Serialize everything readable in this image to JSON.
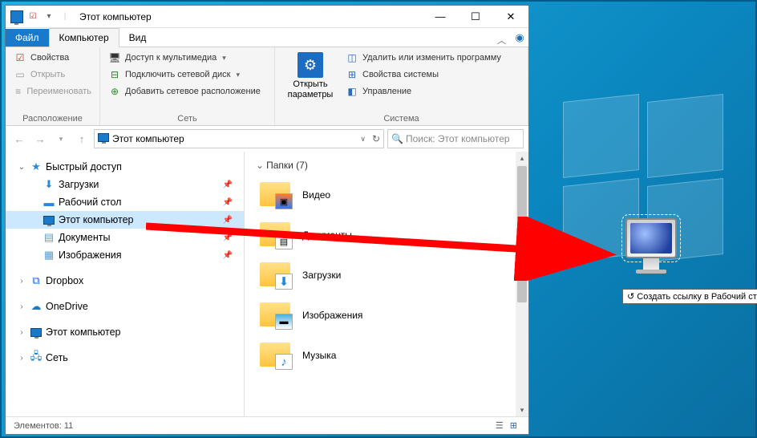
{
  "window": {
    "title": "Этот компьютер",
    "tabs": {
      "file": "Файл",
      "computer": "Компьютер",
      "view": "Вид"
    }
  },
  "ribbon": {
    "group1": {
      "label": "Расположение",
      "properties": "Свойства",
      "open": "Открыть",
      "rename": "Переименовать"
    },
    "group2": {
      "label": "Сеть",
      "media": "Доступ к мультимедиа",
      "mapdrive": "Подключить сетевой диск",
      "addloc": "Добавить сетевое расположение"
    },
    "group3": {
      "label": "Система",
      "big": "Открыть параметры",
      "uninstall": "Удалить или изменить программу",
      "sysprops": "Свойства системы",
      "manage": "Управление"
    }
  },
  "addressbar": {
    "path": "Этот компьютер"
  },
  "search": {
    "placeholder": "Поиск: Этот компьютер"
  },
  "sidebar": {
    "quick": "Быстрый доступ",
    "downloads": "Загрузки",
    "desktop": "Рабочий стол",
    "thispc": "Этот компьютер",
    "documents": "Документы",
    "pictures": "Изображения",
    "dropbox": "Dropbox",
    "onedrive": "OneDrive",
    "thispc2": "Этот компьютер",
    "network": "Сеть"
  },
  "content": {
    "header": "Папки (7)",
    "folders": {
      "video": "Видео",
      "documents": "Документы",
      "downloads": "Загрузки",
      "pictures": "Изображения",
      "music": "Музыка"
    }
  },
  "status": "Элементов: 11",
  "tooltip": "Создать ссылку в Рабочий стол"
}
